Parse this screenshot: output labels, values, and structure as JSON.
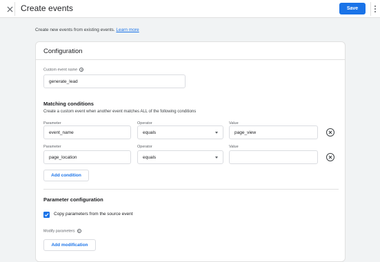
{
  "header": {
    "title": "Create events",
    "save_label": "Save"
  },
  "intro": {
    "text": "Create new events from existing events. ",
    "link": "Learn more"
  },
  "configuration": {
    "title": "Configuration",
    "custom_event_name_label": "Custom event name",
    "custom_event_name_value": "generate_lead"
  },
  "matching": {
    "heading": "Matching conditions",
    "subtitle": "Create a custom event when another event matches ALL of the following conditions",
    "column_labels": {
      "parameter": "Parameter",
      "operator": "Operator",
      "value": "Value"
    },
    "conditions": [
      {
        "parameter": "event_name",
        "operator": "equals",
        "value": "page_view"
      },
      {
        "parameter": "page_location",
        "operator": "equals",
        "value": ""
      }
    ],
    "add_condition_label": "Add condition"
  },
  "parameter_config": {
    "heading": "Parameter configuration",
    "copy_params_label": "Copy parameters from the source event",
    "copy_params_checked": true,
    "modify_params_label": "Modify parameters",
    "add_modification_label": "Add modification"
  },
  "icons": {
    "close": "close-icon",
    "more": "more-vert-icon",
    "help": "help-icon",
    "remove": "remove-circle-icon",
    "caret": "chevron-down-icon",
    "check": "check-icon"
  },
  "colors": {
    "accent": "#1a73e8",
    "background": "#f1f3f4",
    "card": "#ffffff"
  }
}
